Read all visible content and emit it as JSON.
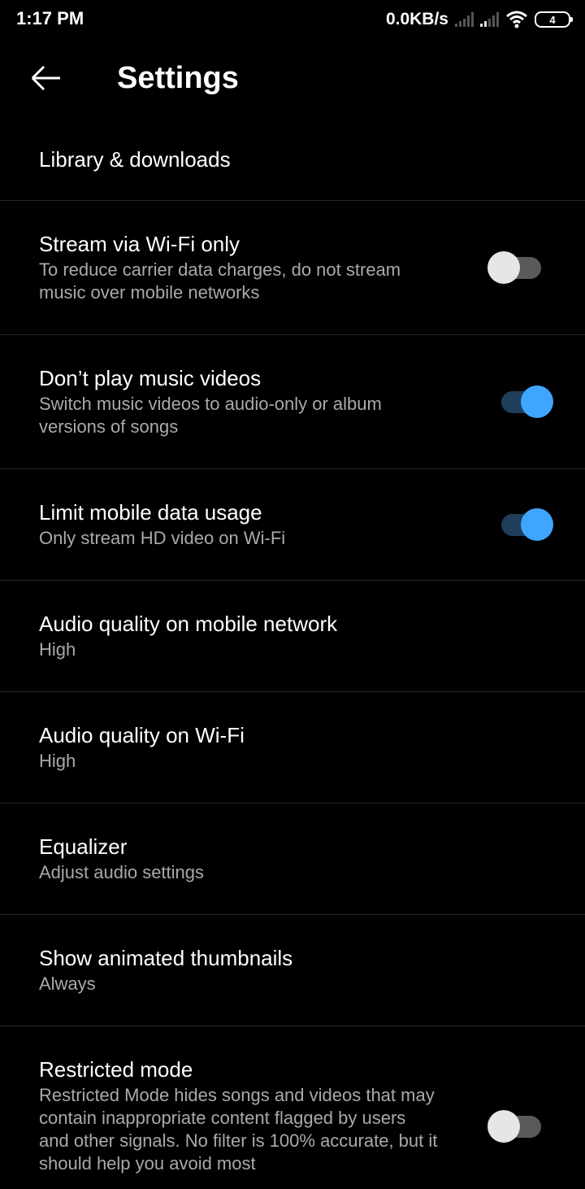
{
  "status_bar": {
    "time": "1:17 PM",
    "net_speed": "0.0KB/s",
    "battery_level": "4",
    "icons": [
      "signal-icon",
      "signal-icon",
      "wifi-icon",
      "battery-icon"
    ]
  },
  "header": {
    "back_icon": "arrow-left-icon",
    "title": "Settings"
  },
  "settings": [
    {
      "title": "Library & downloads"
    },
    {
      "title": "Stream via Wi-Fi only",
      "subtitle": "To reduce carrier data charges, do not stream music over mobile networks",
      "toggle": false
    },
    {
      "title": "Don’t play music videos",
      "subtitle": "Switch music videos to audio-only or album versions of songs",
      "toggle": true
    },
    {
      "title": "Limit mobile data usage",
      "subtitle": "Only stream HD video on Wi-Fi",
      "toggle": true
    },
    {
      "title": "Audio quality on mobile network",
      "subtitle": "High"
    },
    {
      "title": "Audio quality on Wi-Fi",
      "subtitle": "High"
    },
    {
      "title": "Equalizer",
      "subtitle": "Adjust audio settings"
    },
    {
      "title": "Show animated thumbnails",
      "subtitle": "Always"
    },
    {
      "title": "Restricted mode",
      "subtitle": "Restricted Mode hides songs and videos that may contain inappropriate content flagged by users and other signals. No filter is 100% accurate, but it should help you avoid most",
      "toggle": false
    }
  ],
  "colors": {
    "background": "#000000",
    "accent": "#3ea6ff",
    "secondary_text": "#a9a9a9"
  }
}
